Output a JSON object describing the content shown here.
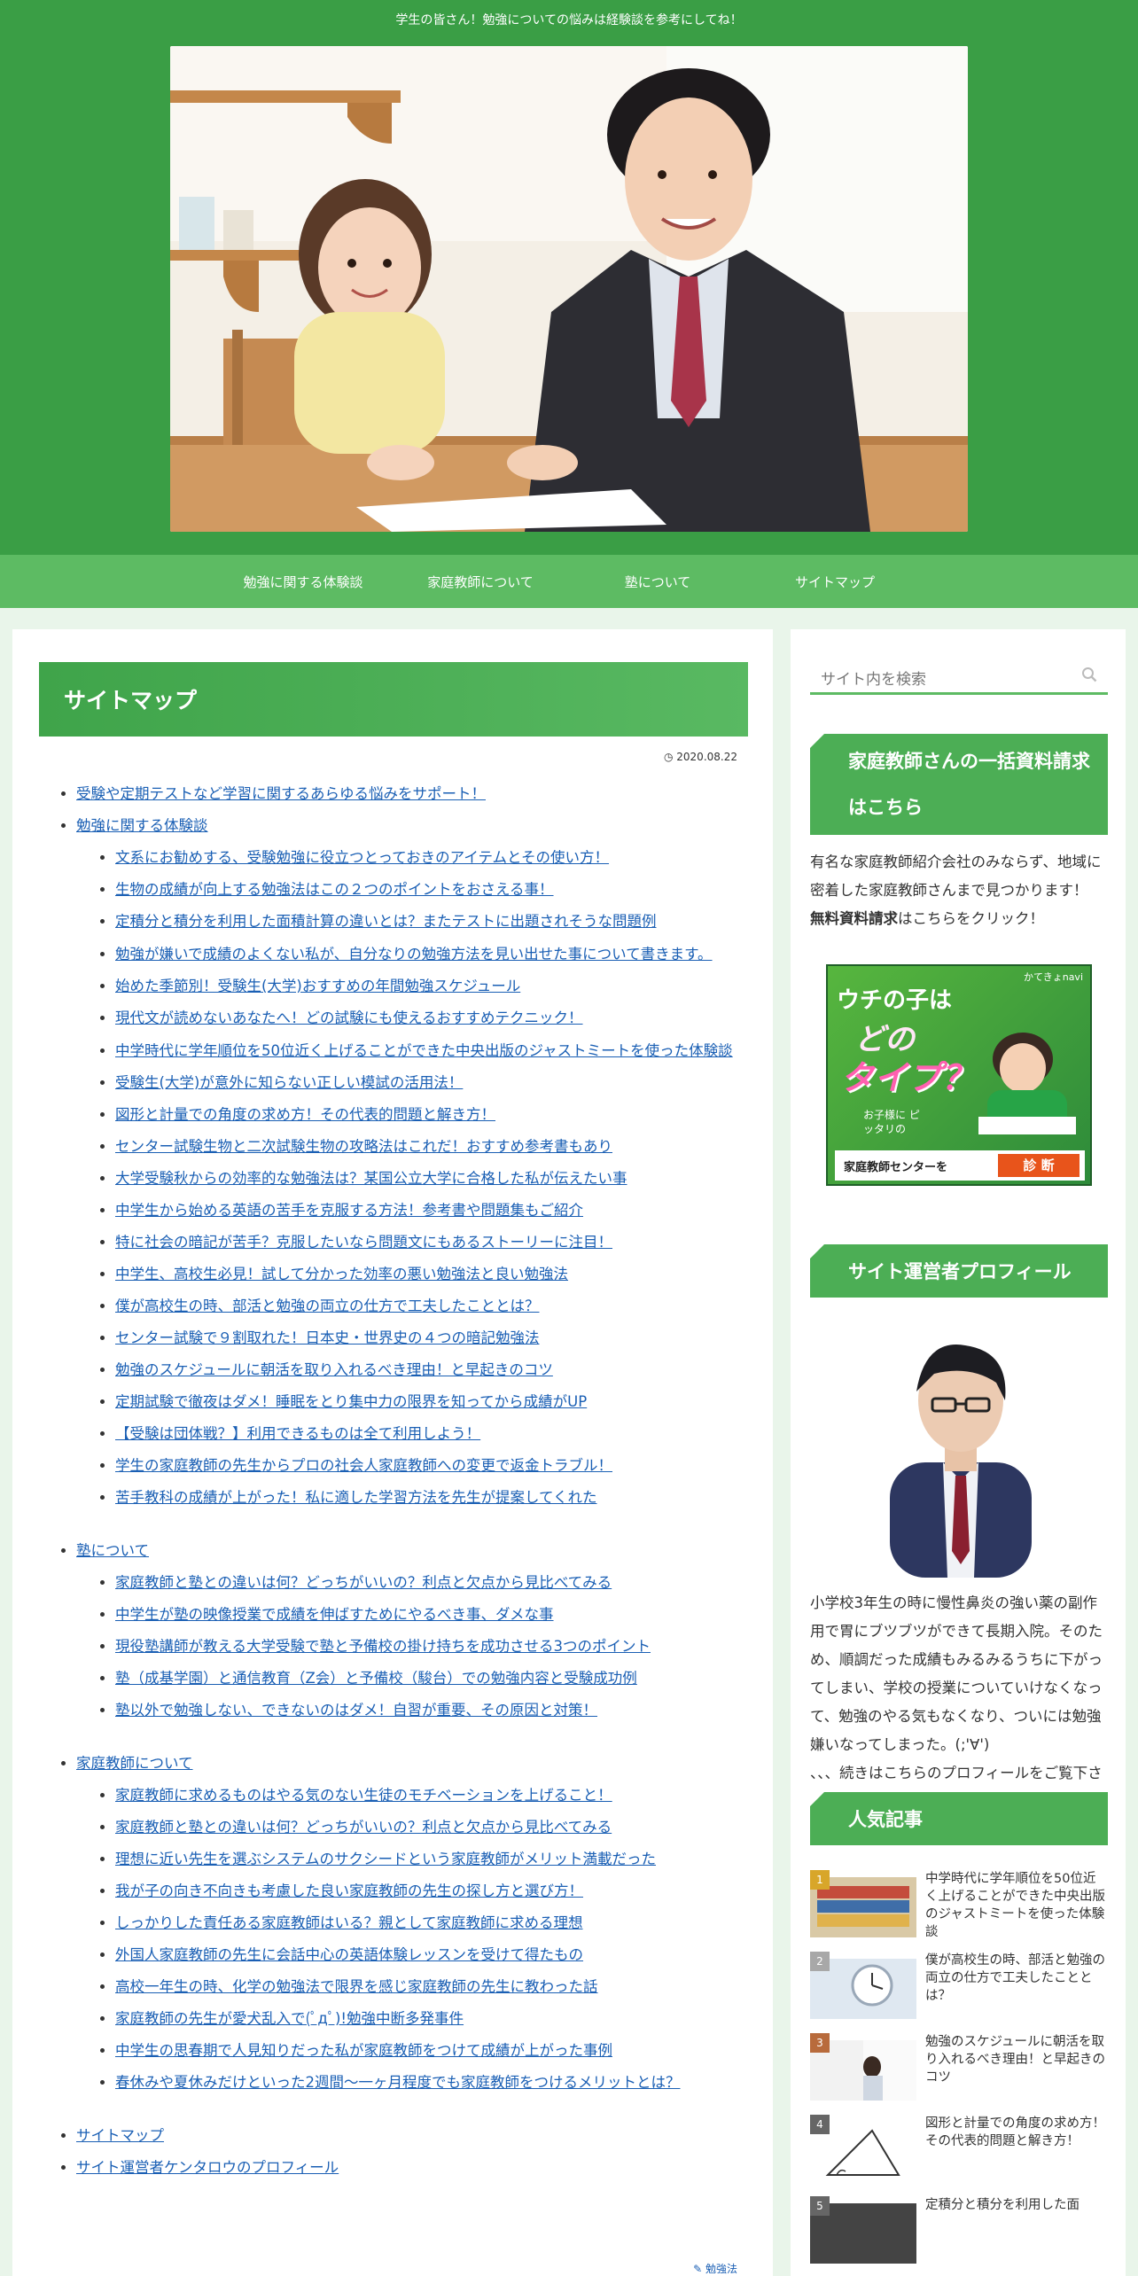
{
  "header": {
    "tagline": "学生の皆さん！勉強についての悩みは経験談を参考にしてね！"
  },
  "nav": {
    "items": [
      {
        "label": "勉強に関する体験談"
      },
      {
        "label": "家庭教師について"
      },
      {
        "label": "塾について"
      },
      {
        "label": "サイトマップ"
      }
    ]
  },
  "main": {
    "page_title": "サイトマップ",
    "date": "2020.08.22",
    "category": "勉強法",
    "sitemap": {
      "top1": "受験や定期テストなど学習に関するあらゆる悩みをサポート！",
      "section1": {
        "title": "勉強に関する体験談",
        "items": [
          "文系にお勧めする、受験勉強に役立つとっておきのアイテムとその使い方！",
          "生物の成績が向上する勉強法はこの２つのポイントをおさえる事！",
          "定積分と積分を利用した面積計算の違いとは？またテストに出題されそうな問題例",
          "勉強が嫌いで成績のよくない私が、自分なりの勉強方法を見い出せた事について書きます。",
          "始めた季節別！受験生(大学)おすすめの年間勉強スケジュール",
          "現代文が読めないあなたへ！どの試験にも使えるおすすめテクニック！",
          "中学時代に学年順位を50位近く上げることができた中央出版のジャストミートを使った体験談",
          "受験生(大学)が意外に知らない正しい模試の活用法！",
          "図形と計量での角度の求め方！その代表的問題と解き方！",
          "センター試験生物と二次試験生物の攻略法はこれだ！おすすめ参考書もあり",
          "大学受験秋からの効率的な勉強法は？某国公立大学に合格した私が伝えたい事",
          "中学生から始める英語の苦手を克服する方法！参考書や問題集もご紹介",
          "特に社会の暗記が苦手？克服したいなら問題文にもあるストーリーに注目！",
          "中学生、高校生必見！試して分かった効率の悪い勉強法と良い勉強法",
          "僕が高校生の時、部活と勉強の両立の仕方で工夫したこととは？",
          "センター試験で９割取れた！日本史・世界史の４つの暗記勉強法",
          "勉強のスケジュールに朝活を取り入れるべき理由！と早起きのコツ",
          "定期試験で徹夜はダメ！睡眠をとり集中力の限界を知ってから成績がUP",
          "【受験は団体戦？】利用できるものは全て利用しよう！",
          "学生の家庭教師の先生からプロの社会人家庭教師への変更で返金トラブル！",
          "苦手教科の成績が上がった！私に適した学習方法を先生が提案してくれた"
        ]
      },
      "section2": {
        "title": "塾について",
        "items": [
          "家庭教師と塾との違いは何？どっちがいいの？利点と欠点から見比べてみる",
          "中学生が塾の映像授業で成績を伸ばすためにやるべき事、ダメな事",
          "現役塾講師が教える大学受験で塾と予備校の掛け持ちを成功させる3つのポイント",
          "塾（成基学園）と通信教育（Z会）と予備校（駿台）での勉強内容と受験成功例",
          "塾以外で勉強しない、できないのはダメ！自習が重要、その原因と対策！"
        ]
      },
      "section3": {
        "title": "家庭教師について",
        "items": [
          "家庭教師に求めるものはやる気のない生徒のモチベーションを上げること！",
          "家庭教師と塾との違いは何？どっちがいいの？利点と欠点から見比べてみる",
          "理想に近い先生を選ぶシステムのサクシードという家庭教師がメリット満載だった",
          "我が子の向き不向きも考慮した良い家庭教師の先生の探し方と選び方！",
          "しっかりした責任ある家庭教師はいる？親として家庭教師に求める理想",
          "外国人家庭教師の先生に会話中心の英語体験レッスンを受けて得たもの",
          "高校一年生の時、化学の勉強法で限界を感じ家庭教師の先生に教わった話",
          "家庭教師の先生が愛犬乱入で(ﾟдﾟ)!勉強中断多発事件",
          "中学生の思春期で人見知りだった私が家庭教師をつけて成績が上がった事例",
          "春休みや夏休みだけといった2週間〜一ヶ月程度でも家庭教師をつけるメリットとは？"
        ]
      },
      "bottom": [
        "サイトマップ",
        "サイト運営者ケンタロウのプロフィール"
      ]
    }
  },
  "sidebar": {
    "search_placeholder": "サイト内を検索",
    "widget1": {
      "title": "家庭教師さんの一括資料請求はこちら",
      "text": "有名な家庭教師紹介会社のみならず、地域に密着した家庭教師さんまで見つかります！",
      "bold": "無料資料請求",
      "tail": "はこちらをクリック！"
    },
    "banner": {
      "brand": "かてきょnavi",
      "headline1": "ウチの子は",
      "headline2": "どの",
      "headline3": "タイプ？",
      "sub": "お子様に ピッタリの",
      "cta_left": "家庭教師センターを",
      "cta_button": "診 断"
    },
    "widget2": {
      "title": "サイト運営者プロフィール",
      "text": "小学校3年生の時に慢性鼻炎の強い薬の副作用で胃にブツブツができて長期入院。そのため、順調だった成績もみるみるうちに下がってしまい、学校の授業についていけなくなって、勉強のやる気もなくなり、ついには勉強嫌いなってしまった。(;'∀')",
      "text2": "、、、続きはこちらのプロフィールをご覧下さい。"
    },
    "widget3": {
      "title": "人気記事",
      "items": [
        {
          "rank": "1",
          "title": "中学時代に学年順位を50位近く上げることができた中央出版のジャストミートを使った体験談"
        },
        {
          "rank": "2",
          "title": "僕が高校生の時、部活と勉強の両立の仕方で工夫したこととは？"
        },
        {
          "rank": "3",
          "title": "勉強のスケジュールに朝活を取り入れるべき理由！と早起きのコツ"
        },
        {
          "rank": "4",
          "title": "図形と計量での角度の求め方！その代表的問題と解き方！"
        },
        {
          "rank": "5",
          "title": "定積分と積分を利用した面"
        }
      ]
    }
  },
  "colors": {
    "header_green": "#3a9e45",
    "nav_green": "#5dbb63",
    "title_green": "#4cae55",
    "page_bg": "#e9f5ea",
    "link": "#1a5fb4"
  }
}
